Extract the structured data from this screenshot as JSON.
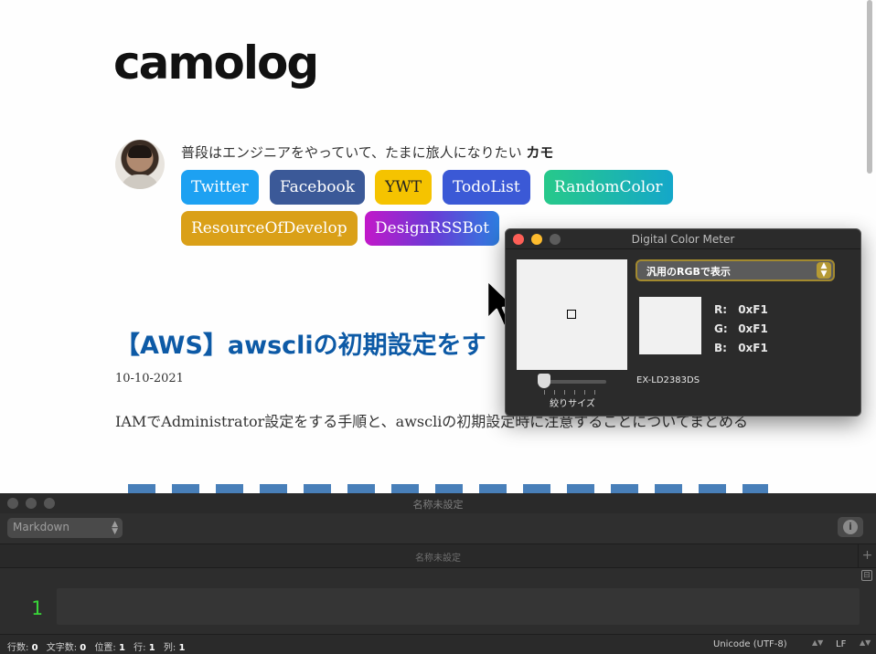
{
  "blog": {
    "site_title": "camolog",
    "bio_text": "普段はエンジニアをやっていて、たまに旅人になりたい",
    "bio_name": "カモ",
    "tags": [
      {
        "label": "Twitter",
        "color": "#1da1f2"
      },
      {
        "label": "Facebook",
        "color": "#3b5998"
      },
      {
        "label": "YWT",
        "color": "#f5c300"
      },
      {
        "label": "TodoList",
        "color": "#3b59d6"
      },
      {
        "label": "RandomColor",
        "color": "#1fb9a8"
      },
      {
        "label": "ResourceOfDevelop",
        "color": "#daa018"
      },
      {
        "label": "DesignRSSBot",
        "color": "#b92ad6"
      }
    ],
    "post_title": "【AWS】awscliの初期設定をす",
    "post_date": "10-10-2021",
    "post_summary": "IAMでAdministrator設定をする手順と、awscliの初期設定時に注意することについてまとめる"
  },
  "color_meter": {
    "title": "Digital Color Meter",
    "mode_select": "汎用のRGBで表示",
    "r_label": "R:",
    "g_label": "G:",
    "b_label": "B:",
    "r_value": "0xF1",
    "g_value": "0xF1",
    "b_value": "0xF1",
    "display_name": "EX-LD2383DS",
    "aperture_label": "絞りサイズ",
    "sampled_color": "#f1f1f1"
  },
  "editor": {
    "window_title": "名称未設定",
    "syntax_select": "Markdown",
    "tab_title": "名称未設定",
    "line_number": "1",
    "status": {
      "lines_label": "行数:",
      "lines_value": "0",
      "chars_label": "文字数:",
      "chars_value": "0",
      "pos_label": "位置:",
      "pos_value": "1",
      "row_label": "行:",
      "row_value": "1",
      "col_label": "列:",
      "col_value": "1",
      "encoding": "Unicode (UTF-8)",
      "line_ending": "LF"
    }
  }
}
